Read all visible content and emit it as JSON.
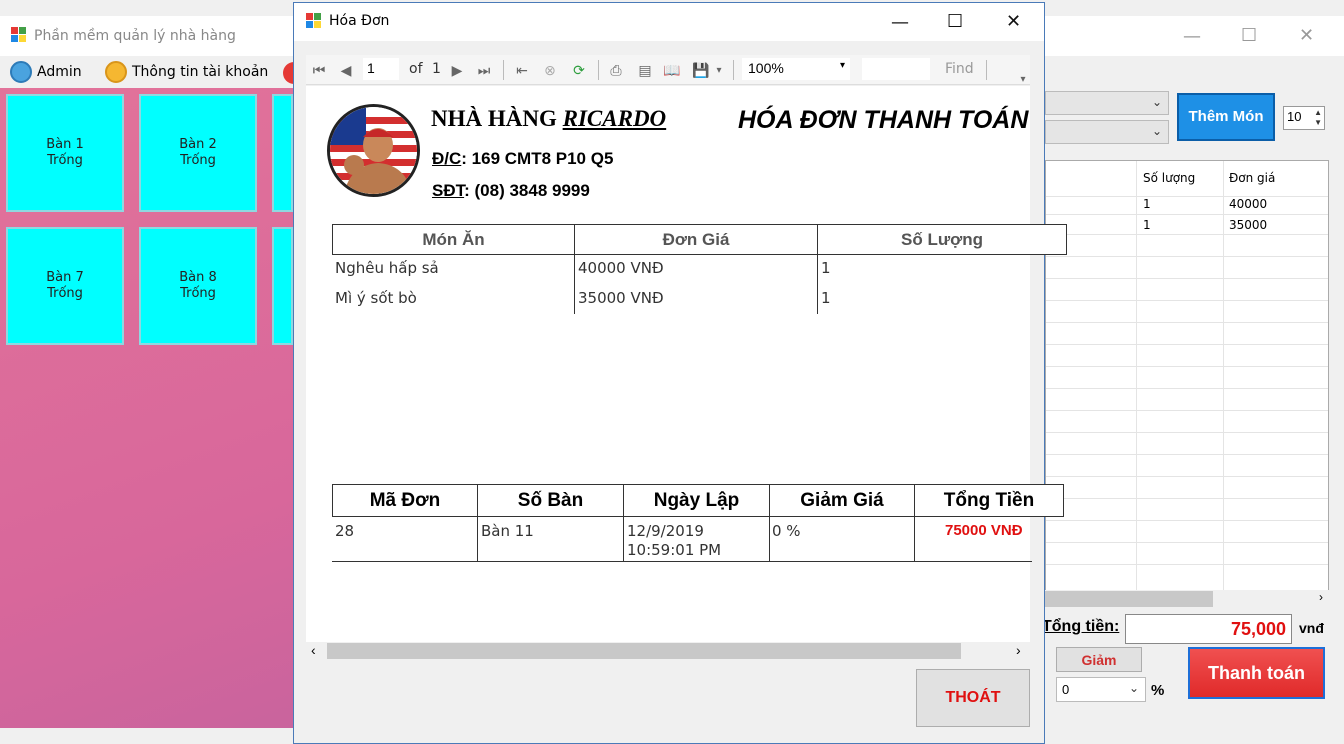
{
  "main_window": {
    "title": "Phần mềm quản lý nhà hàng",
    "menu": [
      {
        "label": "Admin",
        "icon": "admin-icon"
      },
      {
        "label": "Thông tin tài khoản",
        "icon": "account-icon"
      }
    ],
    "tables": [
      {
        "name": "Bàn 1",
        "status": "Trống"
      },
      {
        "name": "Bàn 2",
        "status": "Trống"
      },
      {
        "name": "Bàn 7",
        "status": "Trống"
      },
      {
        "name": "Bàn 8",
        "status": "Trống"
      }
    ],
    "them_mon_label": "Thêm Món",
    "quantity_value": "10",
    "order_grid": {
      "headers": [
        "Số lượng",
        "Đơn giá"
      ],
      "rows": [
        [
          "1",
          "40000"
        ],
        [
          "1",
          "35000"
        ]
      ]
    },
    "total_label": "Tổng tiền:",
    "total_value": "75,000",
    "currency_label": "vnđ",
    "discount_button": "Giảm",
    "discount_value": "0",
    "percent_label": "%",
    "pay_button": "Thanh toán"
  },
  "invoice_dialog": {
    "title": "Hóa Đơn",
    "toolbar": {
      "page_value": "1",
      "of_label": "of",
      "total_pages": "1",
      "zoom": "100%",
      "find_label": "Find"
    },
    "report": {
      "restaurant_prefix": "NHÀ HÀNG",
      "restaurant_name": "RICARDO",
      "heading": "HÓA ĐƠN THANH TOÁN",
      "address_label": "Đ/C",
      "address_value": ": 169 CMT8 P10 Q5",
      "phone_label": "SĐT",
      "phone_value": ": (08) 3848 9999",
      "items_headers": [
        "Món Ăn",
        "Đơn Giá",
        "Số Lượng"
      ],
      "items": [
        {
          "name": "Nghêu hấp sả",
          "price": "40000 VNĐ",
          "qty": "1"
        },
        {
          "name": "Mì ý sốt bò",
          "price": "35000 VNĐ",
          "qty": "1"
        }
      ],
      "summary_headers": [
        "Mã Đơn",
        "Số Bàn",
        "Ngày Lập",
        "Giảm Giá",
        "Tổng Tiền"
      ],
      "summary": {
        "order_id": "28",
        "table": "Bàn 11",
        "date": "12/9/2019 10:59:01 PM",
        "discount": "0 %",
        "total": "75000 VNĐ"
      }
    },
    "exit_button": "THOÁT"
  },
  "colors": {
    "table_cell": "#00ffff",
    "background_gradient_start": "#e2739a",
    "background_gradient_end": "#b860a0",
    "total_red": "#e01010",
    "them_mon_blue": "#1e90e6",
    "pay_red": "#e02a2a"
  }
}
